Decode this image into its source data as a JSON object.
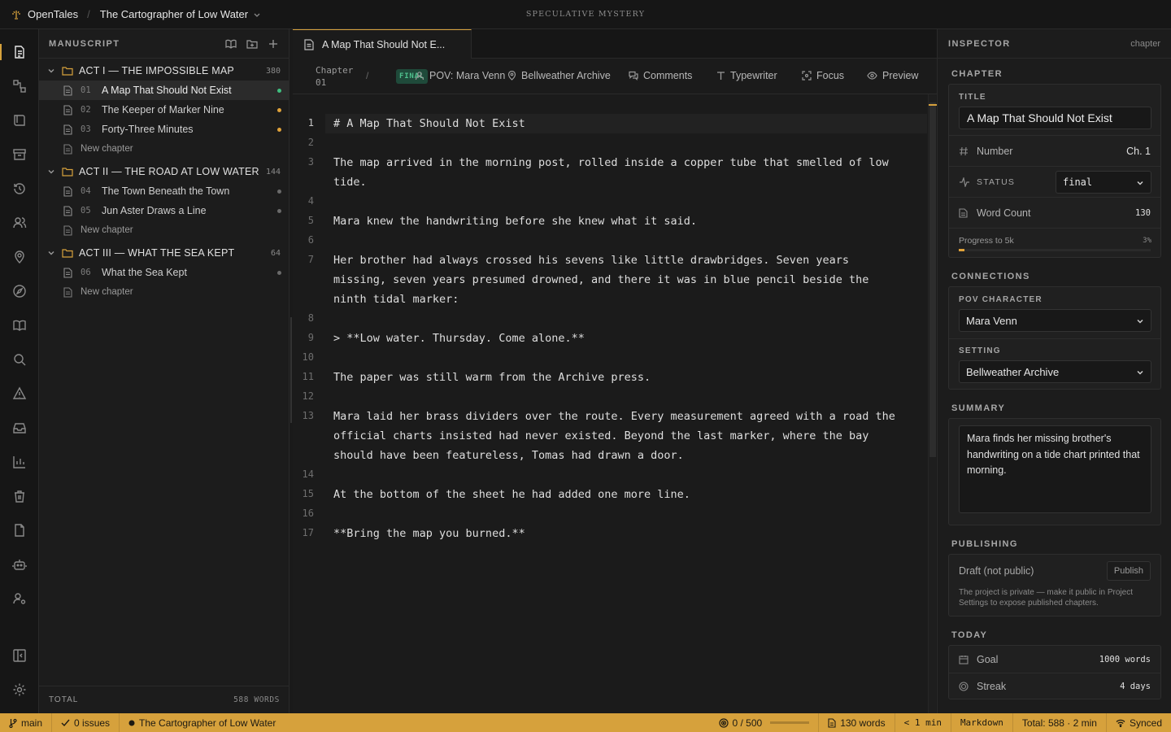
{
  "app": {
    "name": "OpenTales",
    "project": "The Cartographer of Low Water",
    "genre": "SPECULATIVE MYSTERY"
  },
  "rail": {
    "icons": [
      "manuscript-icon",
      "graph-icon",
      "book-icon",
      "archive-icon",
      "history-icon",
      "characters-icon",
      "location-icon",
      "compass-icon",
      "reading-icon",
      "search-icon",
      "warning-icon",
      "inbox-icon",
      "stats-icon",
      "trash-icon",
      "file-icon",
      "bot-icon",
      "user-settings-icon",
      "panel-toggle-icon",
      "settings-icon"
    ]
  },
  "manuscript": {
    "title": "MANUSCRIPT",
    "acts": [
      {
        "title": "ACT I — THE IMPOSSIBLE MAP",
        "count": "380",
        "chapters": [
          {
            "num": "01",
            "title": "A Map That Should Not Exist",
            "dot": "#3fbf7f"
          },
          {
            "num": "02",
            "title": "The Keeper of Marker Nine",
            "dot": "#e0a23a"
          },
          {
            "num": "03",
            "title": "Forty-Three Minutes",
            "dot": "#e0a23a"
          }
        ]
      },
      {
        "title": "ACT II — THE ROAD AT LOW WATER",
        "count": "144",
        "chapters": [
          {
            "num": "04",
            "title": "The Town Beneath the Town",
            "dot": "#6a6a6a"
          },
          {
            "num": "05",
            "title": "Jun Aster Draws a Line",
            "dot": "#6a6a6a"
          }
        ]
      },
      {
        "title": "ACT III — WHAT THE SEA KEPT",
        "count": "64",
        "chapters": [
          {
            "num": "06",
            "title": "What the Sea Kept",
            "dot": "#6a6a6a"
          }
        ]
      }
    ],
    "new_chapter": "New chapter",
    "total_label": "TOTAL",
    "total_value": "588 WORDS"
  },
  "editor": {
    "tab": "A Map That Should Not E...",
    "chapter_label": "Chapter 01",
    "slash": "/",
    "status_badge": "FINAL",
    "pov": "POV: Mara Venn",
    "setting": "Bellweather Archive",
    "comments": "Comments",
    "typewriter": "Typewriter",
    "focus": "Focus",
    "preview": "Preview",
    "line_numbers": [
      "1",
      "2",
      "3",
      "4",
      "5",
      "6",
      "7",
      "8",
      "9",
      "10",
      "11",
      "12",
      "13",
      "14",
      "15",
      "16",
      "17"
    ],
    "lines": [
      "# A Map That Should Not Exist",
      "The map arrived in the morning post, rolled inside a copper tube that smelled of low",
      "tide.",
      "Mara knew the handwriting before she knew what it said.",
      "Her brother had always crossed his sevens like little drawbridges. Seven years",
      "missing, seven years presumed drowned, and there it was in blue pencil beside the",
      "ninth tidal marker:",
      "> **Low water. Thursday. Come alone.**",
      "The paper was still warm from the Archive press.",
      "Mara laid her brass dividers over the route. Every measurement agreed with a road the",
      "official charts insisted had never existed. Beyond the last marker, where the bay",
      "should have been featureless, Tomas had drawn a door.",
      "At the bottom of the sheet he had added one more line.",
      "**Bring the map you burned.**"
    ]
  },
  "inspector": {
    "title": "INSPECTOR",
    "tag": "chapter",
    "chapter_section": "CHAPTER",
    "title_label": "TITLE",
    "title_value": "A Map That Should Not Exist",
    "number_label": "Number",
    "number_value": "Ch. 1",
    "status_label": "STATUS",
    "status_value": "final",
    "wordcount_label": "Word Count",
    "wordcount_value": "130",
    "progress_label": "Progress to 5k",
    "progress_value": "3%",
    "progress_fraction": 0.03,
    "connections_section": "CONNECTIONS",
    "pov_label": "POV CHARACTER",
    "pov_value": "Mara Venn",
    "setting_label": "SETTING",
    "setting_value": "Bellweather Archive",
    "summary_section": "SUMMARY",
    "summary": "Mara finds her missing brother's handwriting on a tide chart printed that morning.",
    "publishing_section": "PUBLISHING",
    "publish_state": "Draft (not public)",
    "publish_button": "Publish",
    "publish_note": "The project is private — make it public in Project Settings to expose published chapters.",
    "today_section": "TODAY",
    "goal_label": "Goal",
    "goal_value": "1000 words",
    "streak_label": "Streak",
    "streak_value": "4 days"
  },
  "statusbar": {
    "branch": "main",
    "issues": "0 issues",
    "project": "The Cartographer of Low Water",
    "goal": "0 / 500",
    "goal_fraction": 0,
    "words": "130 words",
    "read_time": "< 1 min",
    "mode": "Markdown",
    "total": "Total: 588 · 2 min",
    "sync": "Synced"
  },
  "colors": {
    "accent": "#d6a13c",
    "final_green": "#4fc08d",
    "background": "#1a1a1a"
  }
}
